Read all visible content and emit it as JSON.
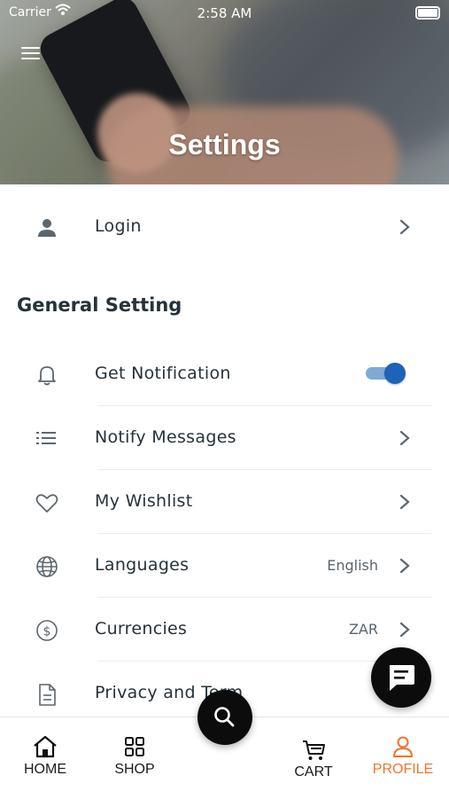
{
  "status_bar": {
    "carrier": "Carrier",
    "time": "2:58 AM"
  },
  "header": {
    "title": "Settings",
    "menu_icon": "hamburger-menu-icon"
  },
  "login_row": {
    "label": "Login",
    "icon": "user-icon"
  },
  "general": {
    "title": "General Setting",
    "items": [
      {
        "label": "Get Notification",
        "icon": "bell-icon",
        "toggle_on": true
      },
      {
        "label": "Notify Messages",
        "icon": "list-icon"
      },
      {
        "label": "My Wishlist",
        "icon": "heart-icon"
      },
      {
        "label": "Languages",
        "icon": "globe-icon",
        "value": "English"
      },
      {
        "label": "Currencies",
        "icon": "dollar-circle-icon",
        "value": "ZAR"
      },
      {
        "label": "Privacy and Term",
        "icon": "document-icon"
      }
    ]
  },
  "fab": {
    "chat_icon": "chat-icon",
    "search_icon": "search-icon"
  },
  "bottom_nav": {
    "items": [
      {
        "label": "HOME",
        "icon": "home-icon"
      },
      {
        "label": "SHOP",
        "icon": "grid-icon"
      },
      {
        "label": "CART",
        "icon": "cart-icon"
      },
      {
        "label": "PROFILE",
        "icon": "profile-icon",
        "active": true
      }
    ]
  },
  "colors": {
    "accent": "#f0742c",
    "toggle": "#1d63b8",
    "text": "#26323a"
  }
}
